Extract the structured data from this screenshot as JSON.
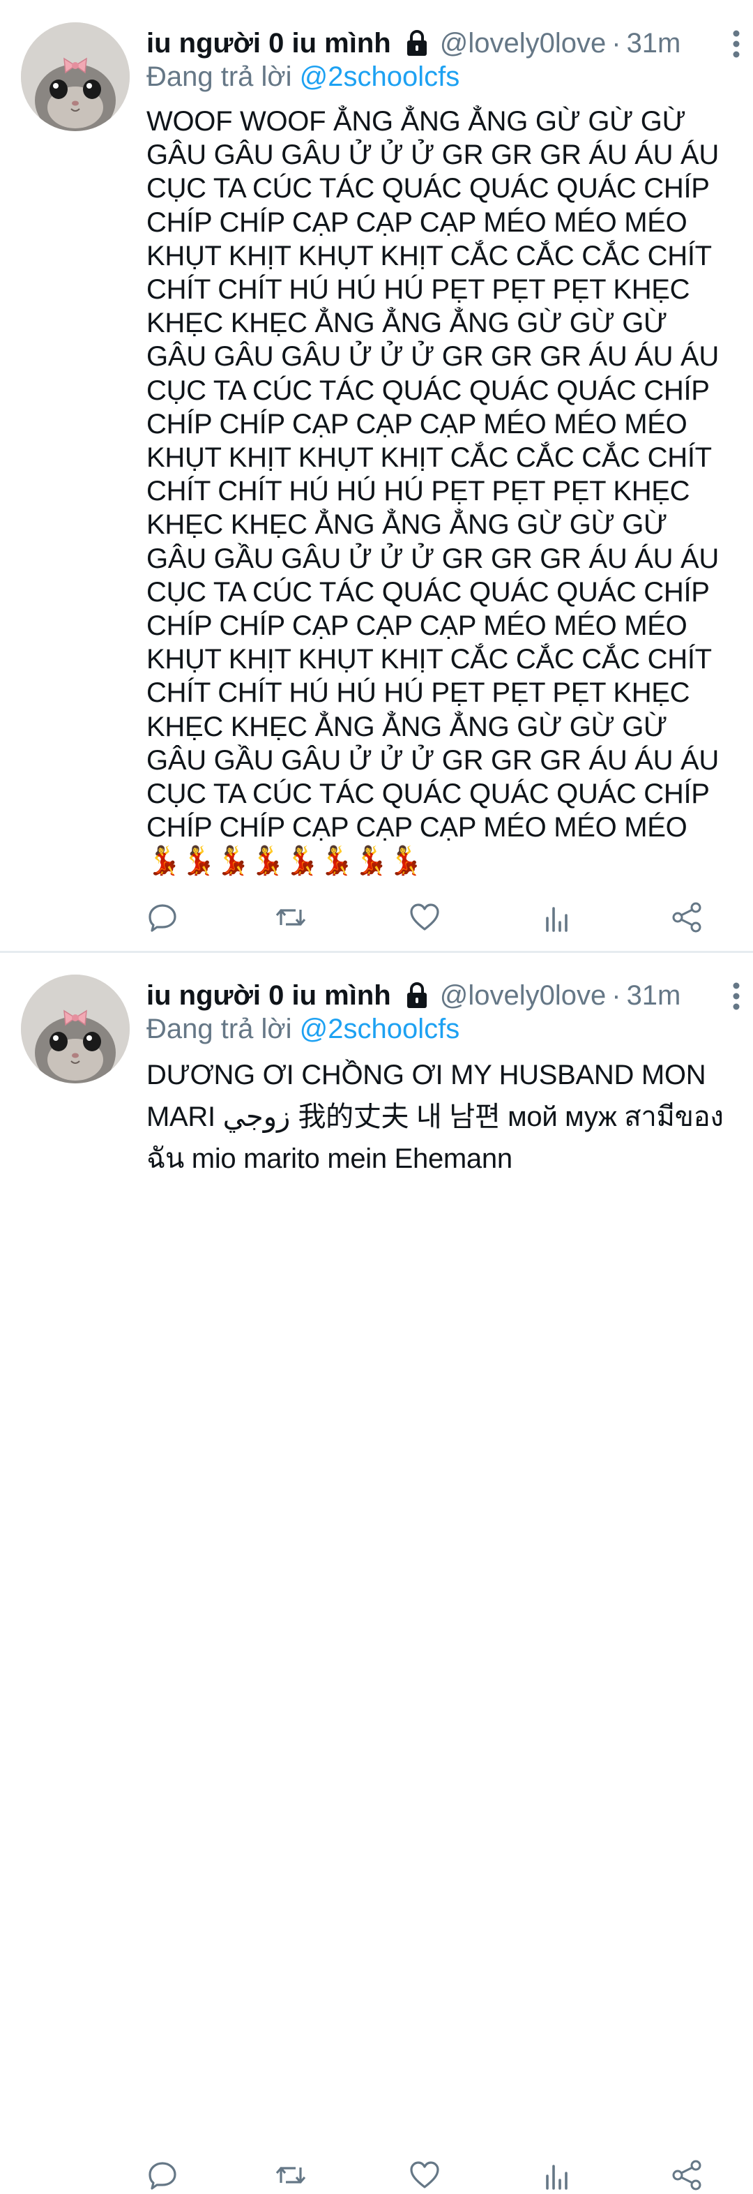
{
  "tweets": [
    {
      "display_name": "iu người 0 iu mình",
      "handle": "@lovely0love",
      "separator": "·",
      "time": "31m",
      "reply_prefix": "Đang trả lời ",
      "reply_to": "@2schoolcfs",
      "text": "WOOF WOOF ẲNG ẲNG ẲNG GỪ GỪ GỪ GÂU GÂU GÂU Ử Ử Ử GR GR GR ÁU ÁU ÁU CỤC TA CÚC TÁC QUÁC QUÁC QUÁC CHÍP CHÍP CHÍP CẠP CẠP CẠP MÉO MÉO MÉO KHỤT KHỊT KHỤT KHỊT CẮC CẮC CẮC CHÍT CHÍT CHÍT HÚ HÚ HÚ PẸT PẸT PẸT KHẸC KHẸC KHẸC ẲNG ẲNG ẲNG GỪ GỪ GỪ GÂU GÂU GÂU Ử Ử Ử GR GR GR ÁU ÁU ÁU CỤC TA CÚC TÁC QUÁC QUÁC QUÁC CHÍP CHÍP CHÍP CẠP CẠP CẠP MÉO MÉO MÉO KHỤT KHỊT KHỤT KHỊT CẮC CẮC CẮC CHÍT CHÍT CHÍT HÚ HÚ HÚ PẸT PẸT PẸT KHẸC KHẸC KHẸC ẲNG ẲNG ẲNG GỪ GỪ GỪ GÂU GẦU GÂU Ử Ử Ử GR GR GR ÁU ÁU ÁU CỤC TA CÚC TÁC QUÁC QUÁC QUÁC CHÍP CHÍP CHÍP CẠP CẠP CẠP MÉO MÉO MÉO KHỤT KHỊT KHỤT KHỊT CẮC CẮC CẮC CHÍT CHÍT CHÍT HÚ HÚ HÚ PẸT PẸT PẸT KHẸC KHẸC KHẸC ẲNG ẲNG ẲNG GỪ GỪ GỪ GÂU GẦU GÂU Ử Ử Ử GR GR GR ÁU ÁU ÁU CỤC TA CÚC TÁC QUÁC QUÁC QUÁC CHÍP CHÍP CHÍP CẠP CẠP CẠP MÉO MÉO MÉO 💃💃💃💃💃💃💃💃",
      "actions": [
        "reply-icon",
        "retweet-icon",
        "like-icon",
        "analytics-icon",
        "share-icon"
      ]
    },
    {
      "display_name": "iu người 0 iu mình",
      "handle": "@lovely0love",
      "separator": "·",
      "time": "31m",
      "reply_prefix": "Đang trả lời ",
      "reply_to": "@2schoolcfs",
      "text": "DƯƠNG ƠI CHỒNG ƠI MY HUSBAND MON MARI زوجي 我的丈夫 내 남편 мой муж สามีของฉัน mio marito mein Ehemann",
      "actions": [
        "reply-icon",
        "retweet-icon",
        "like-icon",
        "analytics-icon",
        "share-icon"
      ]
    }
  ],
  "colors": {
    "text": "#0f1419",
    "secondary": "#657786",
    "link": "#1da1f2",
    "divider": "#e6ecf0",
    "icon": "#657786"
  }
}
